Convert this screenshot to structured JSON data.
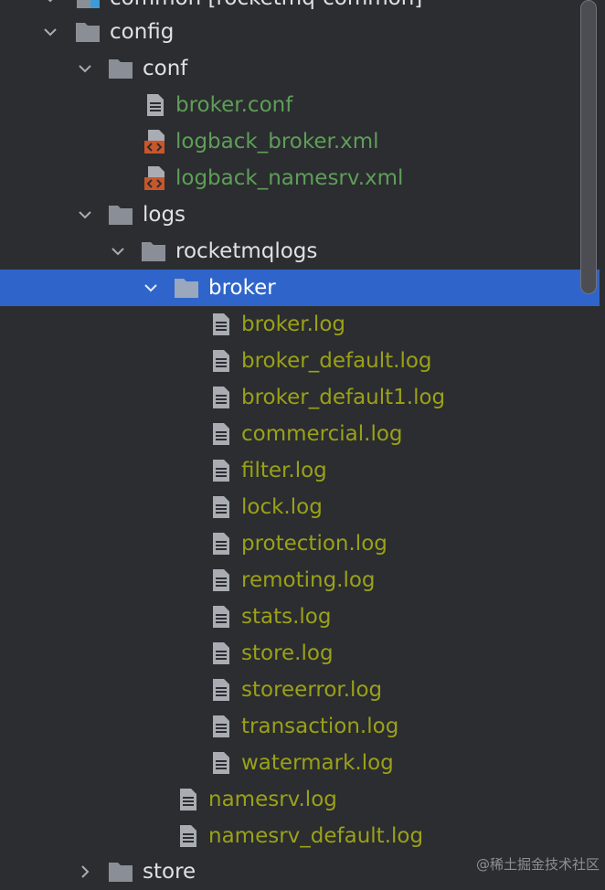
{
  "colors": {
    "background": "#2b2d30",
    "selection": "#2f65ca",
    "folder": "#8a8f97",
    "text_default": "#dfe1e5",
    "text_green": "#5f9e58",
    "text_olive": "#9ba117",
    "xml_icon": "#c9562a"
  },
  "tree": {
    "top_partial": {
      "label": "common [rocketmq-common]",
      "icon": "module-folder-icon"
    },
    "config": {
      "label": "config",
      "expanded": true,
      "icon": "folder-icon"
    },
    "conf": {
      "label": "conf",
      "expanded": true,
      "icon": "folder-icon"
    },
    "conf_files": [
      {
        "label": "broker.conf",
        "icon": "text-file-icon"
      },
      {
        "label": "logback_broker.xml",
        "icon": "xml-file-icon"
      },
      {
        "label": "logback_namesrv.xml",
        "icon": "xml-file-icon"
      }
    ],
    "logs": {
      "label": "logs",
      "expanded": true,
      "icon": "folder-icon"
    },
    "rocketmqlogs": {
      "label": "rocketmqlogs",
      "expanded": true,
      "icon": "folder-icon"
    },
    "broker": {
      "label": "broker",
      "expanded": true,
      "selected": true,
      "icon": "folder-icon"
    },
    "broker_files": [
      {
        "label": "broker.log"
      },
      {
        "label": "broker_default.log"
      },
      {
        "label": "broker_default1.log"
      },
      {
        "label": "commercial.log"
      },
      {
        "label": "filter.log"
      },
      {
        "label": "lock.log"
      },
      {
        "label": "protection.log"
      },
      {
        "label": "remoting.log"
      },
      {
        "label": "stats.log"
      },
      {
        "label": "store.log"
      },
      {
        "label": "storeerror.log"
      },
      {
        "label": "transaction.log"
      },
      {
        "label": "watermark.log"
      }
    ],
    "rocketmqlogs_files": [
      {
        "label": "namesrv.log"
      },
      {
        "label": "namesrv_default.log"
      }
    ],
    "store": {
      "label": "store",
      "expanded": false,
      "icon": "folder-icon"
    }
  },
  "watermark": "@稀土掘金技术社区"
}
